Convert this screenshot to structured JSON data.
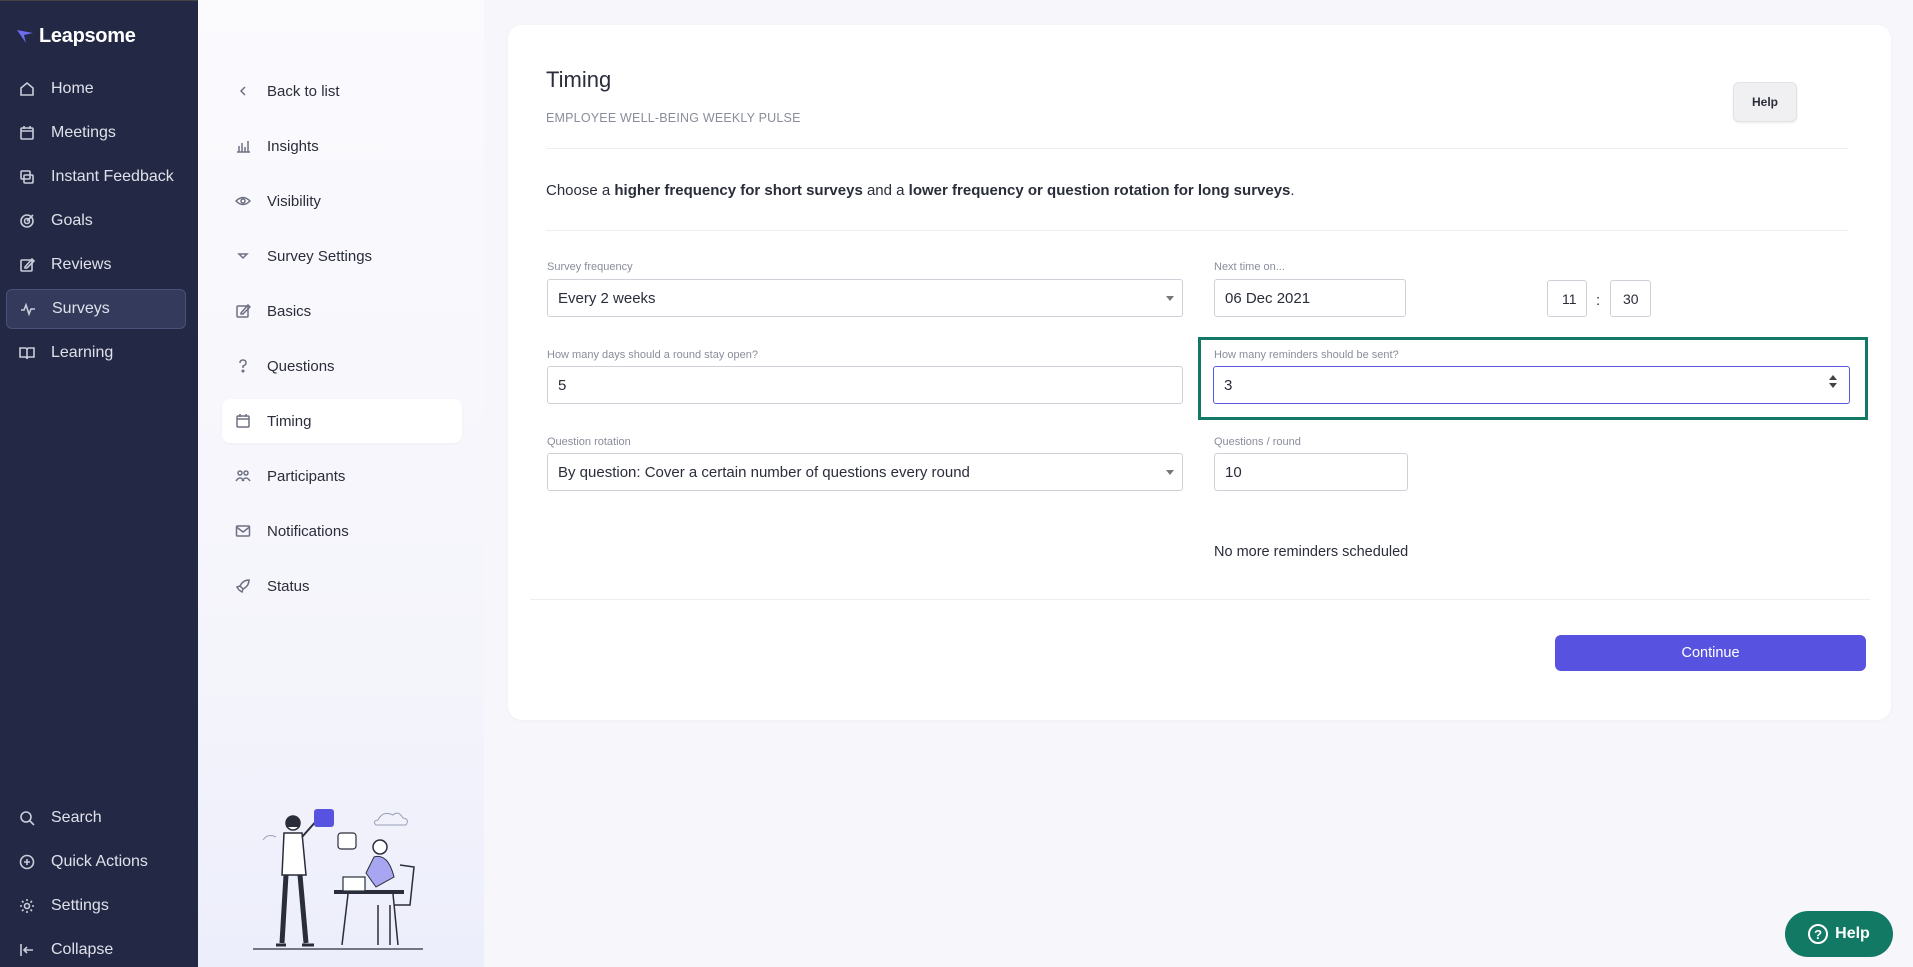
{
  "brand": {
    "name": "Leapsome",
    "accent": "#5753e0",
    "nav_bg": "#232844",
    "highlight": "#127a64"
  },
  "nav": {
    "items": [
      {
        "label": "Home",
        "icon": "home-icon"
      },
      {
        "label": "Meetings",
        "icon": "calendar-icon"
      },
      {
        "label": "Instant Feedback",
        "icon": "feedback-icon"
      },
      {
        "label": "Goals",
        "icon": "target-icon"
      },
      {
        "label": "Reviews",
        "icon": "edit-icon"
      },
      {
        "label": "Surveys",
        "icon": "pulse-icon",
        "active": true
      },
      {
        "label": "Learning",
        "icon": "book-icon"
      }
    ],
    "bottom": [
      {
        "label": "Search",
        "icon": "search-icon"
      },
      {
        "label": "Quick Actions",
        "icon": "plus-circle-icon"
      },
      {
        "label": "Settings",
        "icon": "gear-icon"
      },
      {
        "label": "Collapse",
        "icon": "collapse-icon"
      }
    ]
  },
  "submenu": {
    "items": [
      {
        "label": "Back to list",
        "icon": "chevron-left-icon"
      },
      {
        "label": "Insights",
        "icon": "chart-icon"
      },
      {
        "label": "Visibility",
        "icon": "eye-icon"
      },
      {
        "label": "Survey Settings",
        "icon": "chevron-down-icon"
      },
      {
        "label": "Basics",
        "icon": "edit-icon"
      },
      {
        "label": "Questions",
        "icon": "question-icon"
      },
      {
        "label": "Timing",
        "icon": "calendar-icon",
        "active": true
      },
      {
        "label": "Participants",
        "icon": "users-icon"
      },
      {
        "label": "Notifications",
        "icon": "mail-icon"
      },
      {
        "label": "Status",
        "icon": "rocket-icon"
      }
    ]
  },
  "page": {
    "title": "Timing",
    "subtitle": "EMPLOYEE WELL-BEING WEEKLY PULSE",
    "help_label": "Help",
    "intro": {
      "p1": "Choose a ",
      "b1": "higher frequency for short surveys",
      "p2": " and a ",
      "b2": "lower frequency or question rotation for long surveys",
      "p3": "."
    }
  },
  "form": {
    "frequency": {
      "label": "Survey frequency",
      "value": "Every 2 weeks"
    },
    "next_time": {
      "label": "Next time on...",
      "date": "06 Dec 2021",
      "hour": "11",
      "minute": "30",
      "sep": ":"
    },
    "days_open": {
      "label": "How many days should a round stay open?",
      "value": "5"
    },
    "reminders": {
      "label": "How many reminders should be sent?",
      "value": "3"
    },
    "rotation": {
      "label": "Question rotation",
      "value": "By question: Cover a certain number of questions every round"
    },
    "per_round": {
      "label": "Questions / round",
      "value": "10"
    },
    "note": "No more reminders scheduled"
  },
  "actions": {
    "continue_label": "Continue"
  },
  "help_fab": {
    "label": "Help",
    "icon": "question-circle-icon"
  }
}
